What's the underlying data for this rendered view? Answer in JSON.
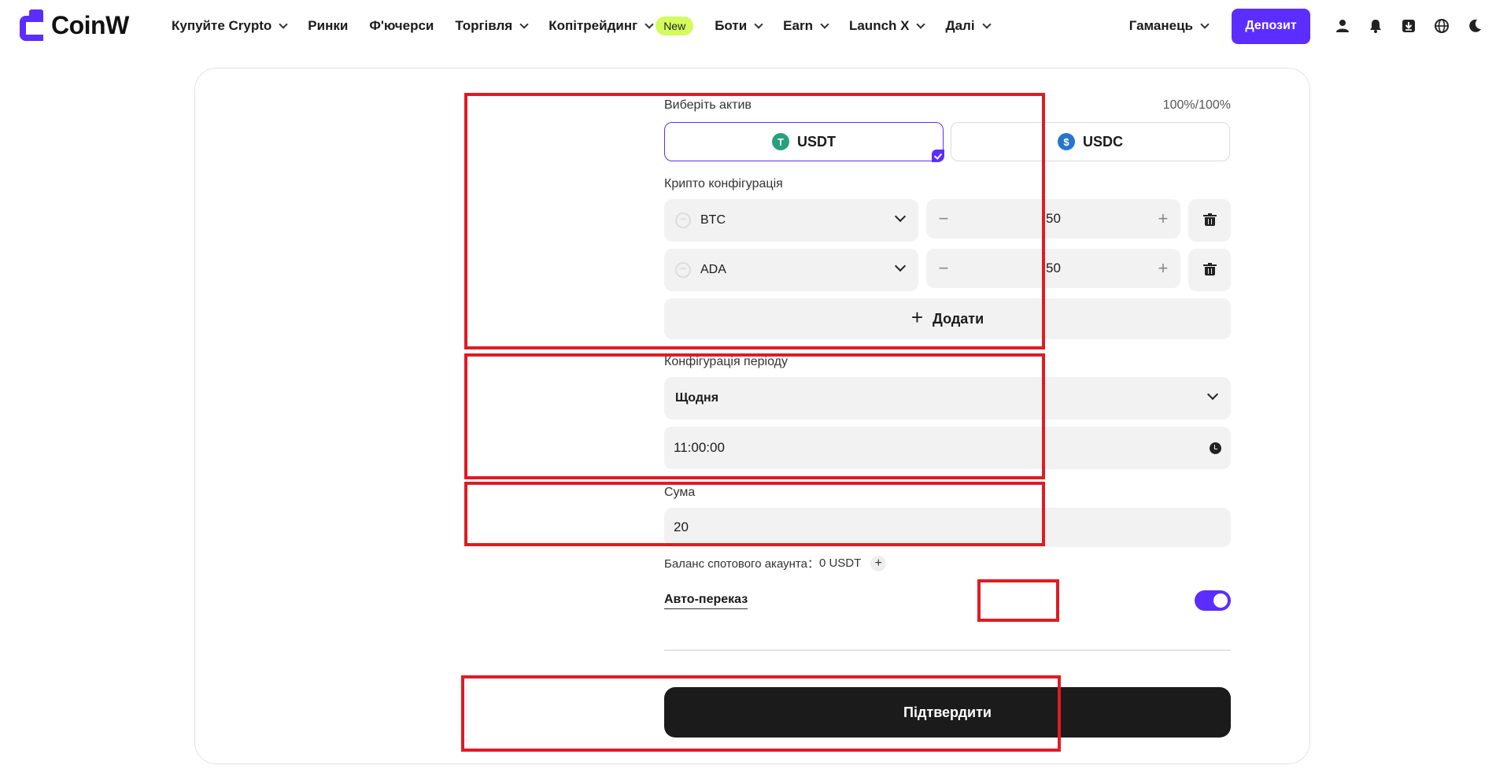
{
  "brand": {
    "name": "CoinW",
    "color": "#5b2dff"
  },
  "nav": [
    {
      "label": "Купуйте Crypto",
      "dropdown": true
    },
    {
      "label": "Ринки",
      "dropdown": false
    },
    {
      "label": "Ф'ючерси",
      "dropdown": false
    },
    {
      "label": "Торгівля",
      "dropdown": true
    },
    {
      "label": "Копітрейдинг",
      "dropdown": true,
      "badge": "New"
    },
    {
      "label": "Боти",
      "dropdown": true
    },
    {
      "label": "Earn",
      "dropdown": true
    },
    {
      "label": "Launch X",
      "dropdown": true
    },
    {
      "label": "Далі",
      "dropdown": true
    }
  ],
  "header_right": {
    "wallet_label": "Гаманець",
    "deposit_label": "Депозит",
    "icons": [
      "user-icon",
      "bell-icon",
      "download-icon",
      "globe-icon",
      "moon-icon"
    ]
  },
  "form": {
    "asset_label": "Виберіть актив",
    "ratio": "100%/100%",
    "assets": [
      {
        "name": "USDT",
        "icon": "tether-icon",
        "color": "#26a17b",
        "selected": true
      },
      {
        "name": "USDC",
        "icon": "usdc-icon",
        "color": "#2775ca",
        "selected": false
      }
    ],
    "crypto_config_label": "Крипто конфігурація",
    "crypto_rows": [
      {
        "coin": "BTC",
        "percent": "50"
      },
      {
        "coin": "ADA",
        "percent": "50"
      }
    ],
    "add_label": "Додати",
    "period_label": "Конфігурація періоду",
    "period_value": "Щодня",
    "time_value": "11:00:00",
    "amount_label": "Сума",
    "amount_value": "20",
    "balance_label": "Баланс спотового акаунта：",
    "balance_value": "0 USDT",
    "auto_transfer_label": "Авто-переказ",
    "auto_transfer_on": true,
    "confirm_label": "Підтвердити"
  },
  "highlight_color": "#e01b24"
}
